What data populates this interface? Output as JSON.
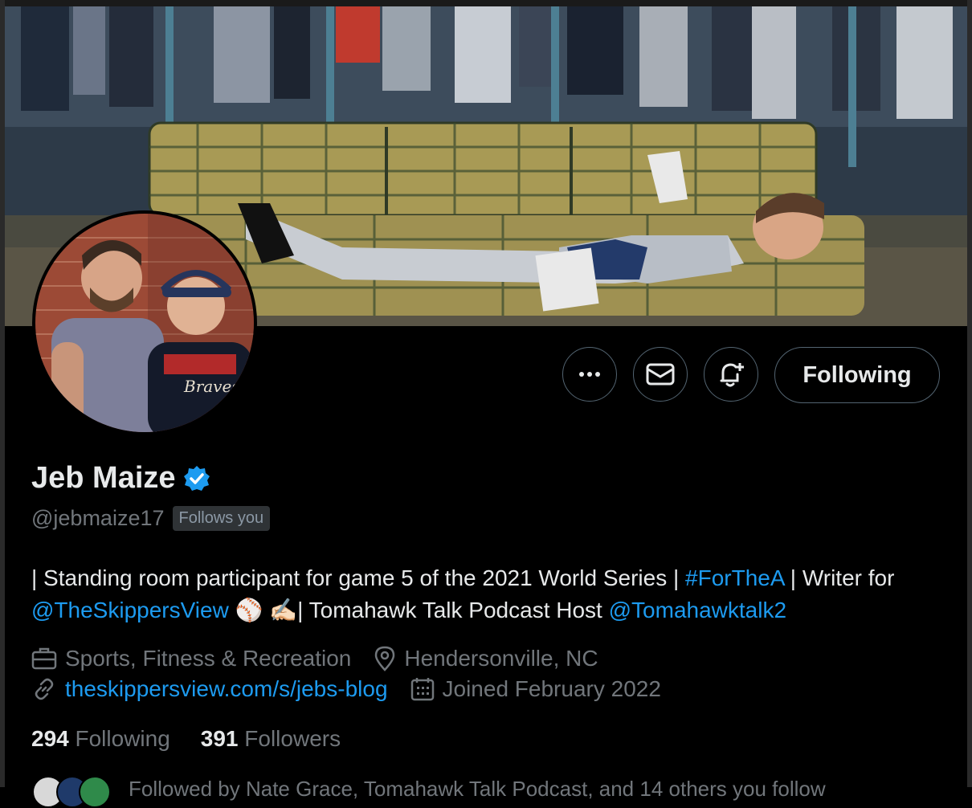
{
  "profile": {
    "display_name": "Jeb Maize",
    "handle": "@jebmaize17",
    "follows_you": "Follows you",
    "verified": true
  },
  "actions": {
    "more_icon": "more-horizontal-icon",
    "message_icon": "mail-icon",
    "notify_icon": "bell-plus-icon",
    "following_label": "Following"
  },
  "bio": {
    "t1": "| Standing room participant for game 5 of the 2021 World Series | ",
    "tag1": "#ForTheA",
    "t2": " | Writer for ",
    "mention1": "@TheSkippersView",
    "t3": " ⚾️ ✍🏻| Tomahawk Talk Podcast Host ",
    "mention2": "@Tomahawktalk2"
  },
  "meta": {
    "category": "Sports, Fitness & Recreation",
    "location": "Hendersonville, NC",
    "website": "theskippersview.com/s/jebs-blog",
    "joined": "Joined February 2022"
  },
  "stats": {
    "following_count": "294",
    "following_label": "Following",
    "followers_count": "391",
    "followers_label": "Followers"
  },
  "followed_by": {
    "text": "Followed by Nate Grace, Tomahawk Talk Podcast, and 14 others you follow"
  },
  "colors": {
    "background": "#000000",
    "text_primary": "#e7e9ea",
    "text_secondary": "#71767b",
    "link": "#1d9bf0",
    "border": "#536471",
    "verified": "#1d9bf0"
  }
}
